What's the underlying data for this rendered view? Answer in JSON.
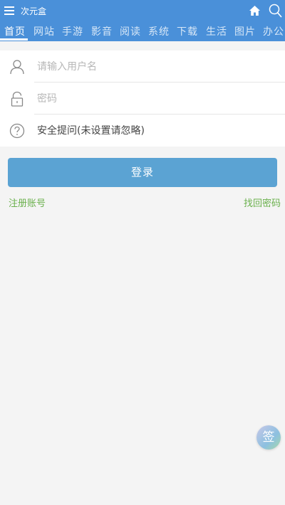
{
  "header": {
    "app_title": "次元盒",
    "tabs": [
      {
        "label": "首页",
        "active": true
      },
      {
        "label": "网站",
        "active": false
      },
      {
        "label": "手游",
        "active": false
      },
      {
        "label": "影音",
        "active": false
      },
      {
        "label": "阅读",
        "active": false
      },
      {
        "label": "系统",
        "active": false
      },
      {
        "label": "下载",
        "active": false
      },
      {
        "label": "生活",
        "active": false
      },
      {
        "label": "图片",
        "active": false
      },
      {
        "label": "办公",
        "active": false
      }
    ]
  },
  "form": {
    "username_placeholder": "请输入用户名",
    "password_placeholder": "密码",
    "security_question": "安全提问(未设置请忽略)",
    "login_label": "登录",
    "register_link": "注册账号",
    "forgot_link": "找回密码"
  },
  "floating": {
    "label": "签"
  },
  "colors": {
    "header": "#4a90d9",
    "button": "#5ba3d3",
    "link": "#6ab04c"
  }
}
